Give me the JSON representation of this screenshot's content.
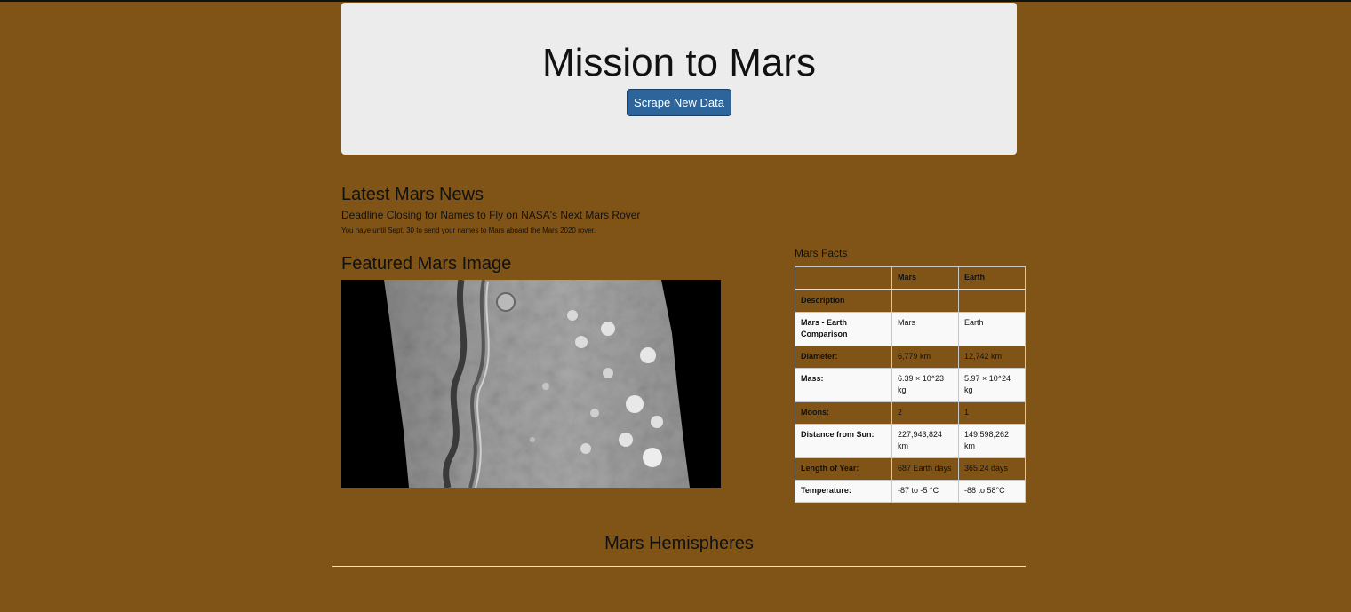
{
  "jumbotron": {
    "title": "Mission to Mars",
    "scrape_button": "Scrape New Data"
  },
  "news": {
    "heading": "Latest Mars News",
    "title": "Deadline Closing for Names to Fly on NASA's Next Mars Rover",
    "teaser": "You have until Sept. 30 to send your names to Mars aboard the Mars 2020 rover."
  },
  "featured": {
    "heading": "Featured Mars Image"
  },
  "facts": {
    "heading": "Mars Facts",
    "columns": [
      "",
      "Mars",
      "Earth"
    ],
    "rows": [
      {
        "label": "Description",
        "mars": "",
        "earth": ""
      },
      {
        "label": "Mars - Earth Comparison",
        "mars": "Mars",
        "earth": "Earth"
      },
      {
        "label": "Diameter:",
        "mars": "6,779 km",
        "earth": "12,742 km"
      },
      {
        "label": "Mass:",
        "mars": "6.39 × 10^23 kg",
        "earth": "5.97 × 10^24 kg"
      },
      {
        "label": "Moons:",
        "mars": "2",
        "earth": "1"
      },
      {
        "label": "Distance from Sun:",
        "mars": "227,943,824 km",
        "earth": "149,598,262 km"
      },
      {
        "label": "Length of Year:",
        "mars": "687 Earth days",
        "earth": "365.24 days"
      },
      {
        "label": "Temperature:",
        "mars": "-87 to -5 °C",
        "earth": "-88 to 58°C"
      }
    ]
  },
  "hemispheres": {
    "heading": "Mars Hemispheres"
  },
  "colors": {
    "page_background": "#805416",
    "jumbotron_background": "#ececec",
    "button_background": "#2d6499",
    "table_stripe": "#f9f9f9"
  }
}
